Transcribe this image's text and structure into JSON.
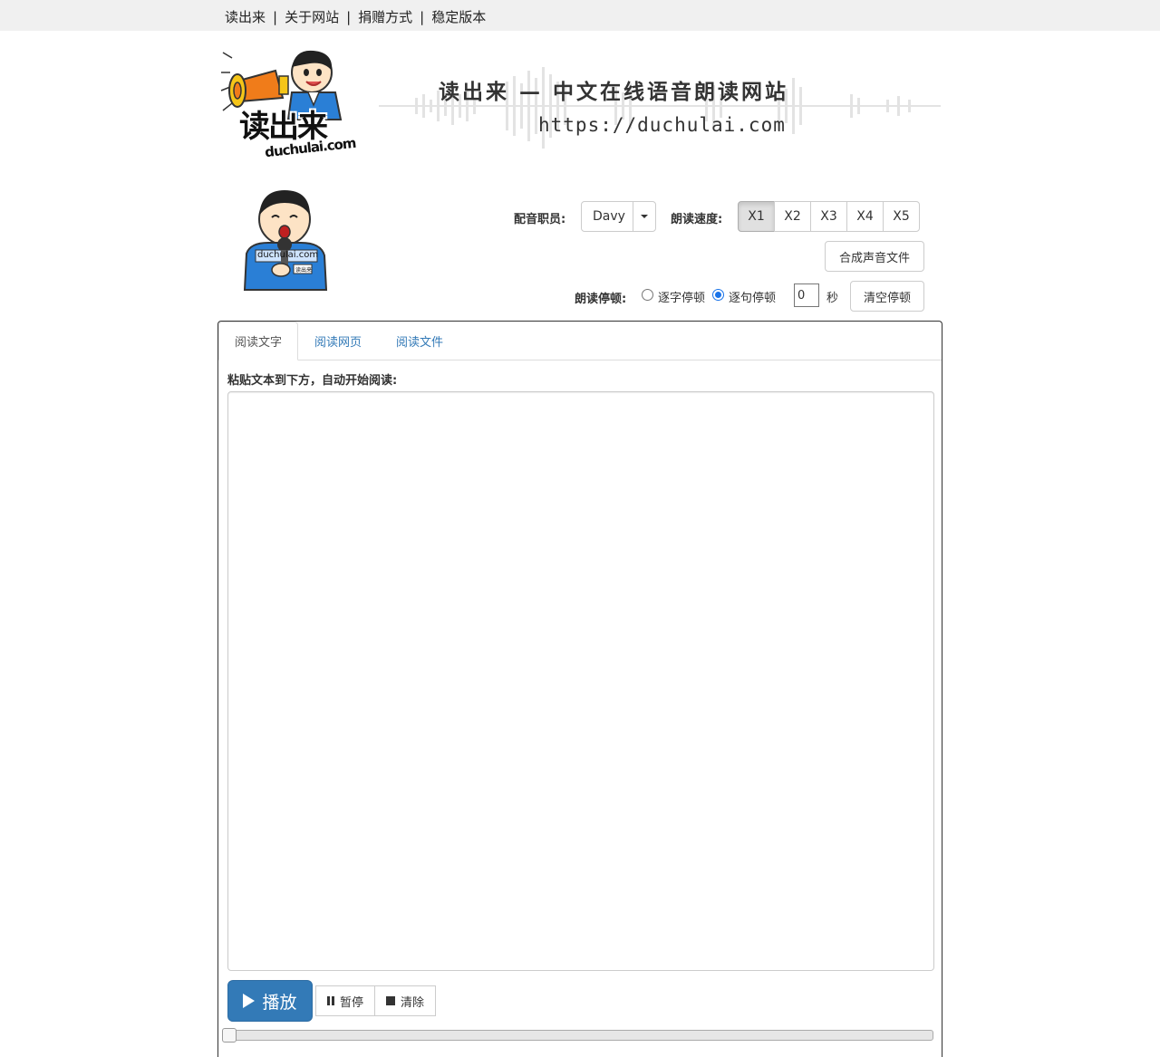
{
  "nav": {
    "items": [
      "读出来",
      "关于网站",
      "捐赠方式",
      "稳定版本"
    ],
    "separator": "|"
  },
  "logo": {
    "main_text": "读出来",
    "domain_text": "duchulai.com"
  },
  "banner": {
    "title": "读出来 — 中文在线语音朗读网站",
    "url": "https://duchulai.com"
  },
  "reporter": {
    "badge_text": "duchulai.com",
    "card_text": "读出来"
  },
  "voice": {
    "label": "配音职员:",
    "selected": "Davy"
  },
  "speed": {
    "label": "朗读速度:",
    "options": [
      "X1",
      "X2",
      "X3",
      "X4",
      "X5"
    ],
    "active": "X1"
  },
  "synthesize_label": "合成声音文件",
  "pause": {
    "label": "朗读停顿:",
    "option_char": "逐字停顿",
    "option_sentence": "逐句停顿",
    "selected": "sentence",
    "seconds_value": "0",
    "seconds_unit": "秒",
    "clear_label": "清空停顿"
  },
  "tabs": [
    {
      "label": "阅读文字",
      "active": true
    },
    {
      "label": "阅读网页",
      "active": false
    },
    {
      "label": "阅读文件",
      "active": false
    }
  ],
  "editor": {
    "hint": "粘贴文本到下方，自动开始阅读:",
    "value": ""
  },
  "controls": {
    "play_label": "播放",
    "pause_label": "暂停",
    "clear_label": "清除"
  },
  "progress": {
    "value": 0
  },
  "colors": {
    "primary": "#337ab7",
    "nav_bg": "#f0f0f0",
    "radio_accent": "#1a73e8",
    "logo_yellow": "#f5c518",
    "logo_orange": "#f07c1a",
    "shirt_blue": "#2a7fd6"
  }
}
